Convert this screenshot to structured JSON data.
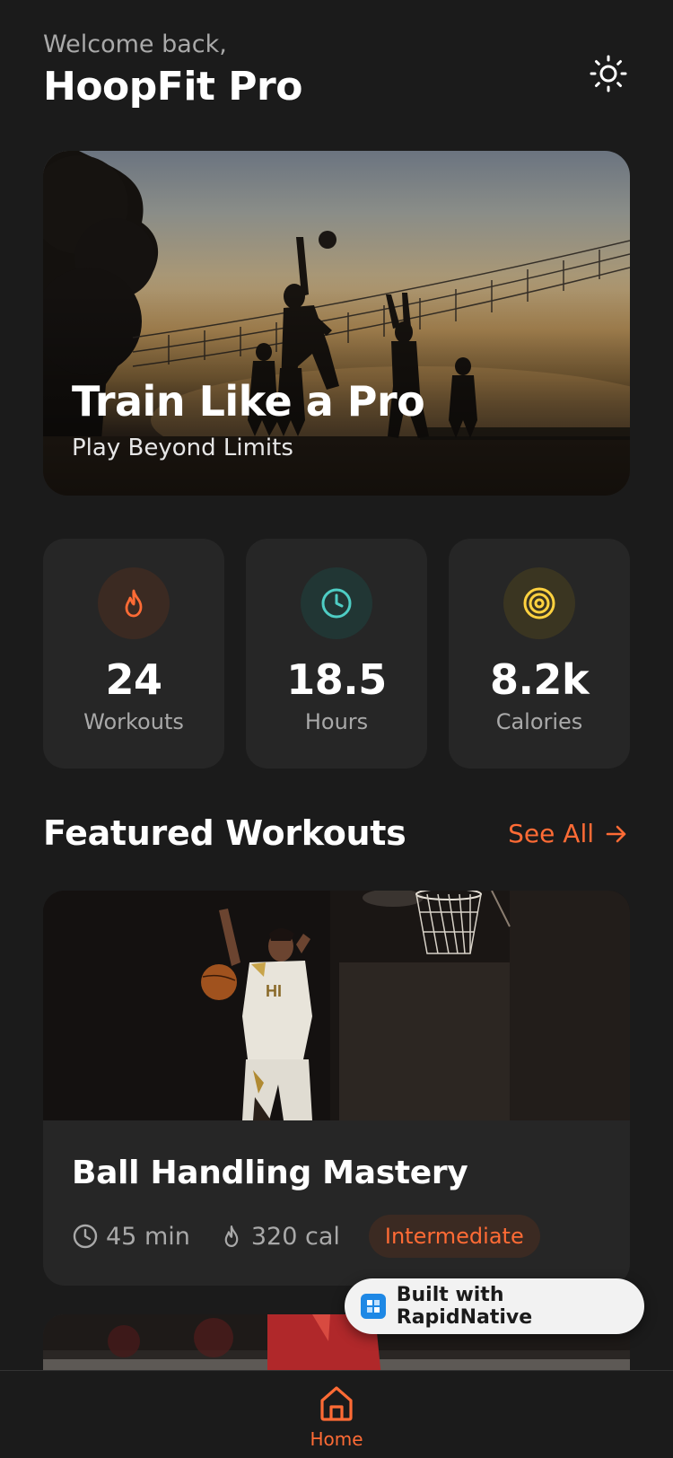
{
  "header": {
    "welcome": "Welcome back,",
    "app_name": "HoopFit Pro",
    "theme_icon": "sun-icon"
  },
  "hero": {
    "title": "Train Like a Pro",
    "subtitle": "Play Beyond Limits"
  },
  "stats": [
    {
      "value": "24",
      "label": "Workouts",
      "icon": "flame-icon",
      "color": "#ff6b35",
      "bg": "#3b2a22"
    },
    {
      "value": "18.5",
      "label": "Hours",
      "icon": "clock-icon",
      "color": "#4ecdc4",
      "bg": "#213634"
    },
    {
      "value": "8.2k",
      "label": "Calories",
      "icon": "target-icon",
      "color": "#ffd23f",
      "bg": "#3a3521"
    }
  ],
  "featured": {
    "title": "Featured Workouts",
    "see_all": "See All",
    "workouts": [
      {
        "title": "Ball Handling Mastery",
        "duration": "45 min",
        "calories": "320 cal",
        "level": "Intermediate"
      }
    ]
  },
  "badge": {
    "text": "Built with RapidNative"
  },
  "nav": {
    "home_label": "Home"
  },
  "colors": {
    "accent": "#ff6b35",
    "background": "#1b1b1b",
    "card": "#262626"
  }
}
